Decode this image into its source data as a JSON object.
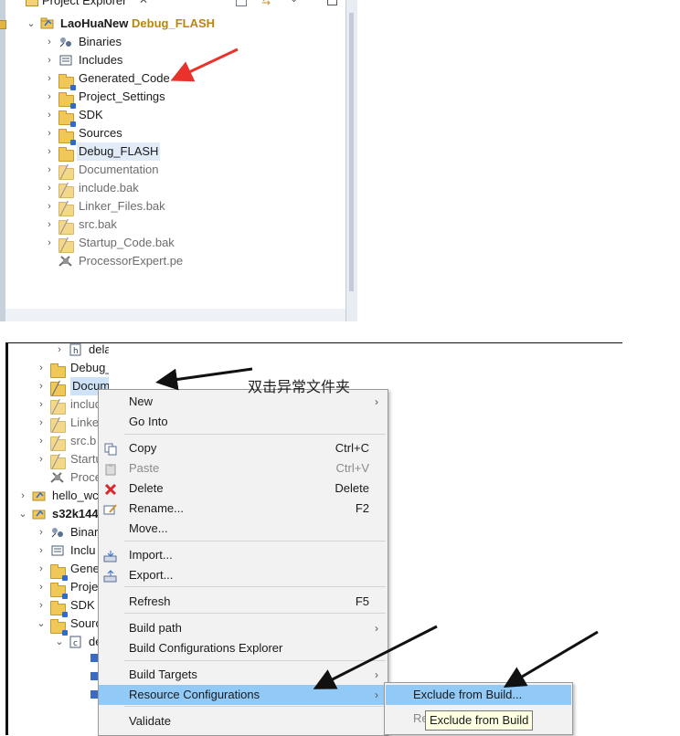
{
  "top": {
    "view_title": "Project Explorer",
    "project_name": "LaoHuaNew",
    "project_config": " Debug_FLASH",
    "items": [
      {
        "label": "Binaries",
        "icon": "binaries-icon",
        "dim": false
      },
      {
        "label": "Includes",
        "icon": "includes-icon",
        "dim": false
      },
      {
        "label": "Generated_Code",
        "icon": "source-folder-icon",
        "dim": false
      },
      {
        "label": "Project_Settings",
        "icon": "source-folder-icon",
        "dim": false
      },
      {
        "label": "SDK",
        "icon": "source-folder-icon",
        "dim": false
      },
      {
        "label": "Sources",
        "icon": "source-folder-icon",
        "dim": false
      },
      {
        "label": "Debug_FLASH",
        "icon": "folder-icon",
        "dim": false
      },
      {
        "label": "Documentation",
        "icon": "excluded-folder-icon",
        "dim": true
      },
      {
        "label": "include.bak",
        "icon": "excluded-folder-icon",
        "dim": true
      },
      {
        "label": "Linker_Files.bak",
        "icon": "excluded-folder-icon",
        "dim": true
      },
      {
        "label": "src.bak",
        "icon": "excluded-folder-icon",
        "dim": true
      },
      {
        "label": "Startup_Code.bak",
        "icon": "excluded-folder-icon",
        "dim": true
      },
      {
        "label": "ProcessorExpert.pe",
        "icon": "processor-expert-icon",
        "dim": true
      }
    ]
  },
  "bottom_tree": [
    {
      "label": "delay.h",
      "indent": 2,
      "chev": "›",
      "icon": "header-file-icon",
      "dim": false
    },
    {
      "label": "Debug_FLASH",
      "indent": 1,
      "chev": "›",
      "icon": "folder-icon",
      "dim": false
    },
    {
      "label": "Documentation",
      "indent": 1,
      "chev": "›",
      "icon": "excluded-folder-icon",
      "dim": false,
      "selected": true
    },
    {
      "label": "include",
      "indent": 1,
      "chev": "›",
      "icon": "excluded-folder-icon",
      "dim": true
    },
    {
      "label": "Linke",
      "indent": 1,
      "chev": "›",
      "icon": "excluded-folder-icon",
      "dim": true
    },
    {
      "label": "src.b",
      "indent": 1,
      "chev": "›",
      "icon": "excluded-folder-icon",
      "dim": true
    },
    {
      "label": "Startu",
      "indent": 1,
      "chev": "›",
      "icon": "excluded-folder-icon",
      "dim": true
    },
    {
      "label": "Proce",
      "indent": 1,
      "chev": "",
      "icon": "processor-expert-icon",
      "dim": true
    },
    {
      "label": "hello_wc",
      "indent": 0,
      "chev": "›",
      "icon": "project-icon",
      "dim": false
    },
    {
      "label": "s32k144",
      "indent": 0,
      "chev": "⌄",
      "icon": "project-icon",
      "dim": false,
      "bold": true
    },
    {
      "label": "Binar",
      "indent": 1,
      "chev": "›",
      "icon": "binaries-icon",
      "dim": false
    },
    {
      "label": "Inclu",
      "indent": 1,
      "chev": "›",
      "icon": "includes-icon",
      "dim": false
    },
    {
      "label": "Gene",
      "indent": 1,
      "chev": "›",
      "icon": "source-folder-icon",
      "dim": false
    },
    {
      "label": "Proje",
      "indent": 1,
      "chev": "›",
      "icon": "source-folder-icon",
      "dim": false
    },
    {
      "label": "SDK",
      "indent": 1,
      "chev": "›",
      "icon": "source-folder-icon",
      "dim": false
    },
    {
      "label": "Sourc",
      "indent": 1,
      "chev": "⌄",
      "icon": "source-folder-icon",
      "dim": false
    },
    {
      "label": "de",
      "indent": 2,
      "chev": "⌄",
      "icon": "c-file-icon",
      "dim": false
    }
  ],
  "menu": {
    "items": [
      {
        "label": "New",
        "shortcut": "",
        "submenu": true,
        "icon": "",
        "disabled": false
      },
      {
        "label": "Go Into",
        "shortcut": "",
        "submenu": false,
        "icon": "",
        "disabled": false
      },
      {
        "label": "Copy",
        "shortcut": "Ctrl+C",
        "submenu": false,
        "icon": "copy-icon",
        "disabled": false
      },
      {
        "label": "Paste",
        "shortcut": "Ctrl+V",
        "submenu": false,
        "icon": "paste-icon",
        "disabled": true
      },
      {
        "label": "Delete",
        "shortcut": "Delete",
        "submenu": false,
        "icon": "delete-icon",
        "disabled": false
      },
      {
        "label": "Rename...",
        "shortcut": "F2",
        "submenu": false,
        "icon": "rename-icon",
        "disabled": false
      },
      {
        "label": "Move...",
        "shortcut": "",
        "submenu": false,
        "icon": "",
        "disabled": false
      },
      {
        "label": "Import...",
        "shortcut": "",
        "submenu": false,
        "icon": "import-icon",
        "disabled": false
      },
      {
        "label": "Export...",
        "shortcut": "",
        "submenu": false,
        "icon": "export-icon",
        "disabled": false
      },
      {
        "label": "Refresh",
        "shortcut": "F5",
        "submenu": false,
        "icon": "",
        "disabled": false
      },
      {
        "label": "Build path",
        "shortcut": "",
        "submenu": true,
        "icon": "",
        "disabled": false
      },
      {
        "label": "Build Configurations Explorer",
        "shortcut": "",
        "submenu": false,
        "icon": "",
        "disabled": false
      },
      {
        "label": "Build Targets",
        "shortcut": "",
        "submenu": true,
        "icon": "",
        "disabled": false
      },
      {
        "label": "Resource Configurations",
        "shortcut": "",
        "submenu": true,
        "icon": "",
        "disabled": false,
        "highlighted": true
      },
      {
        "label": "Validate",
        "shortcut": "",
        "submenu": false,
        "icon": "",
        "disabled": false
      }
    ]
  },
  "submenu": {
    "items": [
      {
        "label": "Exclude from Build...",
        "highlighted": true
      },
      {
        "label": "Re      Ref      ...",
        "highlighted": false
      }
    ]
  },
  "tooltip": "Exclude from Build",
  "annotation": "双击异常文件夹",
  "colors": {
    "folder_fill": "#f0c85a",
    "highlight": "#91c9f7",
    "config_orange": "#b8860b",
    "arrow_red": "#e8322b",
    "arrow_black": "#111111"
  }
}
